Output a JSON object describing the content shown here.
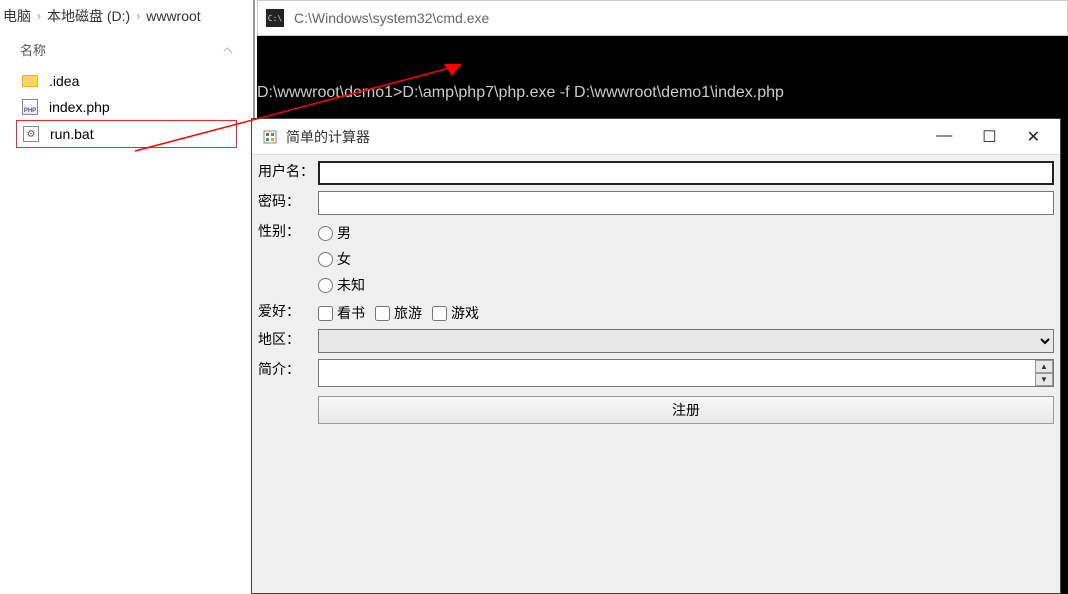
{
  "explorer": {
    "breadcrumb": [
      "电脑",
      "本地磁盘 (D:)",
      "wwwroot"
    ],
    "column_header": "名称",
    "files": [
      {
        "name": ".idea",
        "type": "folder"
      },
      {
        "name": "index.php",
        "type": "php"
      },
      {
        "name": "run.bat",
        "type": "bat",
        "selected": true
      }
    ]
  },
  "cmd": {
    "title": "C:\\Windows\\system32\\cmd.exe",
    "icon_text": "C:\\",
    "line": "D:\\wwwroot\\demo1>D:\\amp\\php7\\php.exe -f D:\\wwwroot\\demo1\\index.php"
  },
  "app": {
    "title": "简单的计算器",
    "labels": {
      "username": "用户名：",
      "password": "密码：",
      "gender": "性别：",
      "hobby": "爱好：",
      "region": "地区：",
      "intro": "简介："
    },
    "gender_options": [
      "男",
      "女",
      "未知"
    ],
    "hobby_options": [
      "看书",
      "旅游",
      "游戏"
    ],
    "submit": "注册",
    "controls": {
      "min": "—",
      "max": "☐",
      "close": "✕"
    }
  }
}
